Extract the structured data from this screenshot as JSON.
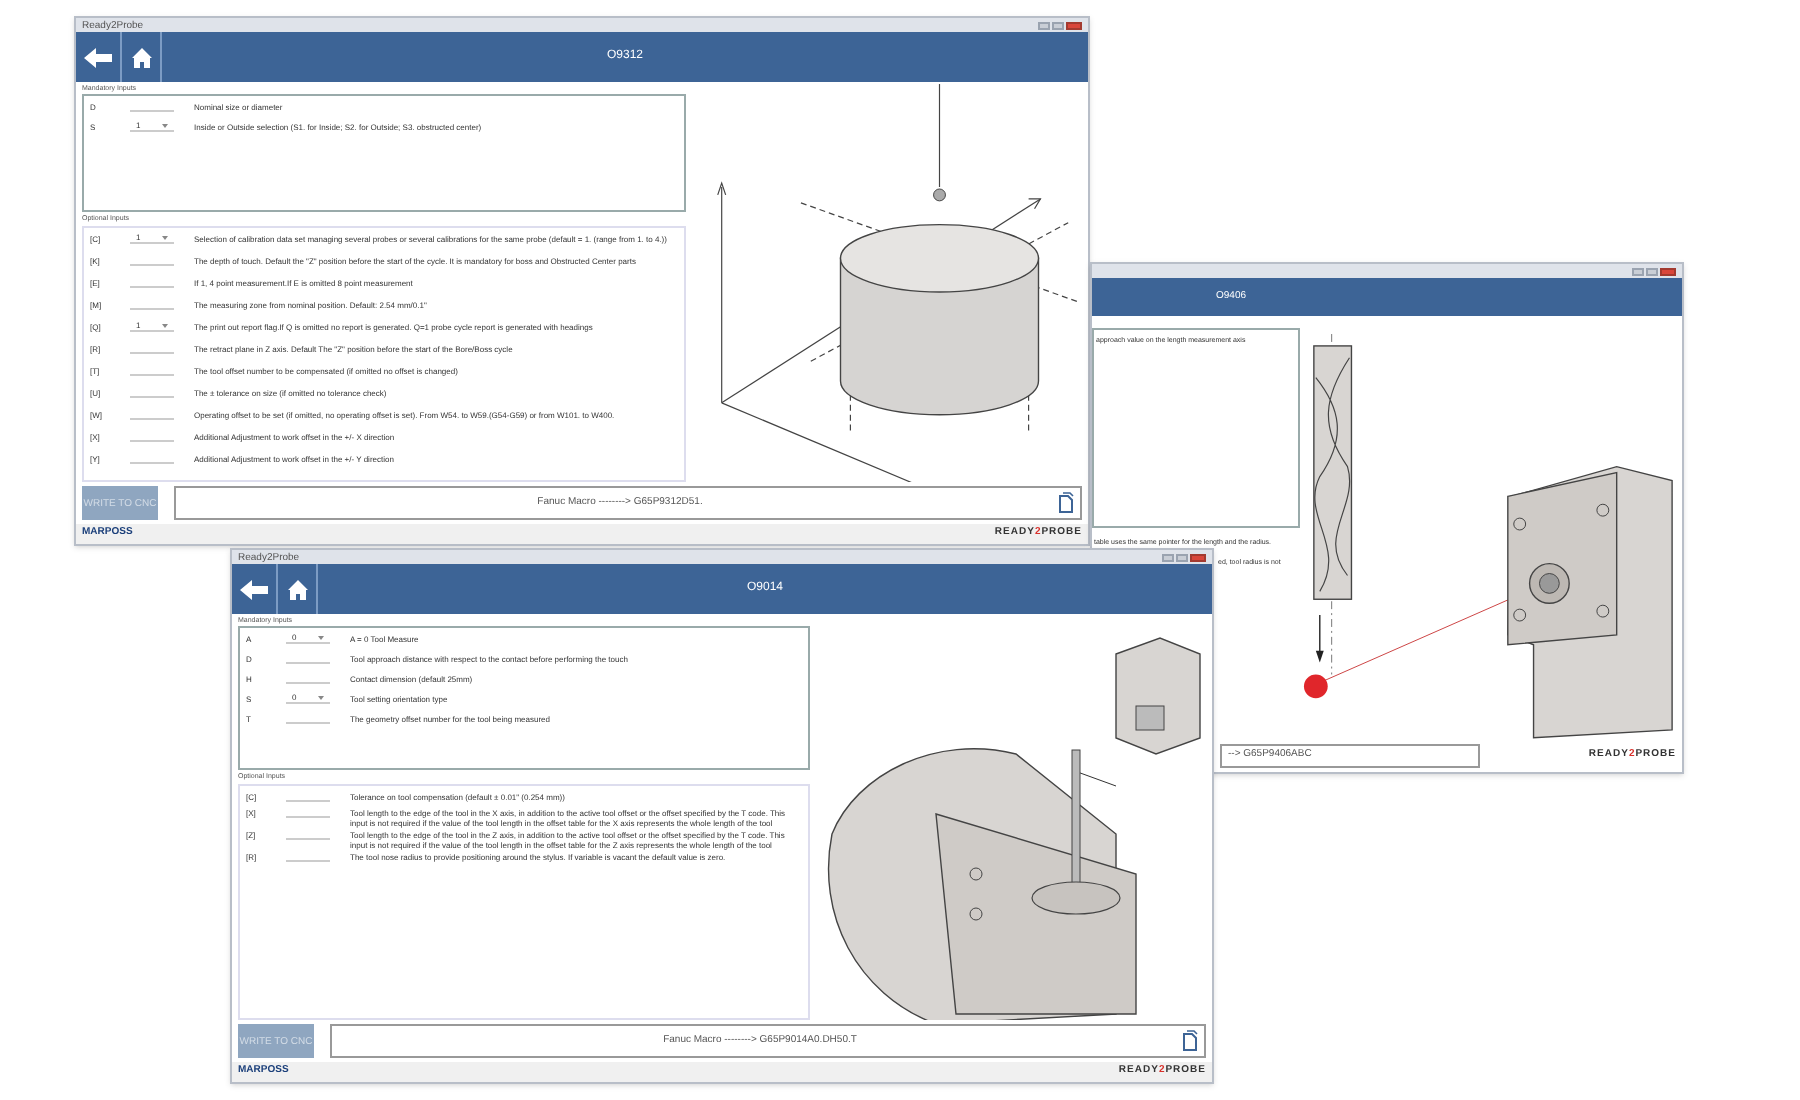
{
  "windows": [
    {
      "kind": "full",
      "app_title": "Ready2Probe",
      "title": "O9312",
      "mandatory_label": "Mandatory Inputs",
      "mandatory_inputs": [
        {
          "code": "D",
          "kind": "field",
          "description": "Nominal size or diameter"
        },
        {
          "code": "S",
          "kind": "dropdown",
          "value": "1",
          "description": "Inside or Outside selection (S1. for Inside; S2. for Outside; S3. obstructed center)"
        }
      ],
      "optional_label": "Optional Inputs",
      "optional_inputs": [
        {
          "code": "[C]",
          "kind": "dropdown",
          "value": "1",
          "description": "Selection of calibration data set managing several probes or several calibrations for the same probe (default = 1. (range from 1. to 4.))"
        },
        {
          "code": "[K]",
          "kind": "field",
          "description": "The depth of touch. Default the \"Z\" position before the start of the cycle. It is mandatory for boss and Obstructed Center parts"
        },
        {
          "code": "[E]",
          "kind": "field",
          "description": "If 1, 4 point measurement.If E is omitted 8 point measurement"
        },
        {
          "code": "[M]",
          "kind": "field",
          "description": "The measuring zone from nominal position. Default: 2.54 mm/0.1\""
        },
        {
          "code": "[Q]",
          "kind": "dropdown",
          "value": "1",
          "description": "The print out report flag.If Q is omitted no report is generated. Q=1 probe cycle report is generated with headings"
        },
        {
          "code": "[R]",
          "kind": "field",
          "description": "The retract plane in Z axis. Default The \"Z\" position before the start of the Bore/Boss cycle"
        },
        {
          "code": "[T]",
          "kind": "field",
          "description": "The tool offset number to be compensated (if omitted no offset is changed)"
        },
        {
          "code": "[U]",
          "kind": "field",
          "description": "The ± tolerance on size (if omitted no tolerance check)"
        },
        {
          "code": "[W]",
          "kind": "field",
          "description": "Operating offset to be set (if omitted, no operating offset is set). From W54. to W59.(G54-G59) or from W101. to W400."
        },
        {
          "code": "[X]",
          "kind": "field",
          "description": "Additional Adjustment to work offset in the +/- X direction"
        },
        {
          "code": "[Y]",
          "kind": "field",
          "description": "Additional Adjustment to work offset in the +/- Y direction"
        }
      ],
      "write_button": {
        "label": "WRITE TO CNC",
        "disabled": true
      },
      "macro": "Fanuc Macro --------> G65P9312D51.",
      "footer": {
        "left": "MARPOSS",
        "brand": [
          "READY",
          "2",
          "PROBE"
        ]
      }
    },
    {
      "kind": "partial",
      "title": "O9406",
      "panel_lines": [
        "approach value on the length measurement axis"
      ],
      "lower_panel_lines": [
        "table uses the same pointer for the length and the radius.",
        "ed, tool radius is not"
      ],
      "macro": "--> G65P9406ABC",
      "footer": {
        "brand": [
          "READY",
          "2",
          "PROBE"
        ]
      }
    },
    {
      "kind": "full",
      "app_title": "Ready2Probe",
      "title": "O9014",
      "mandatory_label": "Mandatory Inputs",
      "mandatory_inputs": [
        {
          "code": "A",
          "kind": "dropdown",
          "value": "0",
          "description": "A = 0 Tool Measure"
        },
        {
          "code": "D",
          "kind": "field",
          "description": "Tool approach distance with respect to the contact before performing the touch"
        },
        {
          "code": "H",
          "kind": "field",
          "description": "Contact dimension (default 25mm)"
        },
        {
          "code": "S",
          "kind": "dropdown",
          "value": "0",
          "description": "Tool setting orientation type"
        },
        {
          "code": "T",
          "kind": "field",
          "description": "The geometry offset number for the tool being measured"
        }
      ],
      "optional_label": "Optional Inputs",
      "optional_inputs": [
        {
          "code": "[C]",
          "kind": "field",
          "description": "Tolerance on tool compensation (default ± 0.01\" (0.254 mm))"
        },
        {
          "code": "[X]",
          "kind": "field",
          "description": "Tool length to the edge of the tool in the X axis, in addition to the active tool offset or the offset specified by the T code. This input is not required if the value of the tool length in the offset table for the X axis represents the whole length of the tool"
        },
        {
          "code": "[Z]",
          "kind": "field",
          "description": "Tool length to the edge of the tool in the Z axis, in addition to the active tool offset or the offset specified by the T code. This input is not required if the value of the tool length in the offset table for the Z axis represents the whole length of the tool"
        },
        {
          "code": "[R]",
          "kind": "field",
          "description": "The tool nose radius to provide positioning around the stylus. If variable is vacant the default value is zero."
        }
      ],
      "write_button": {
        "label": "WRITE TO CNC",
        "disabled": true
      },
      "macro": "Fanuc Macro --------> G65P9014A0.DH50.T",
      "footer": {
        "left": "MARPOSS",
        "brand": [
          "READY",
          "2",
          "PROBE"
        ]
      }
    }
  ]
}
